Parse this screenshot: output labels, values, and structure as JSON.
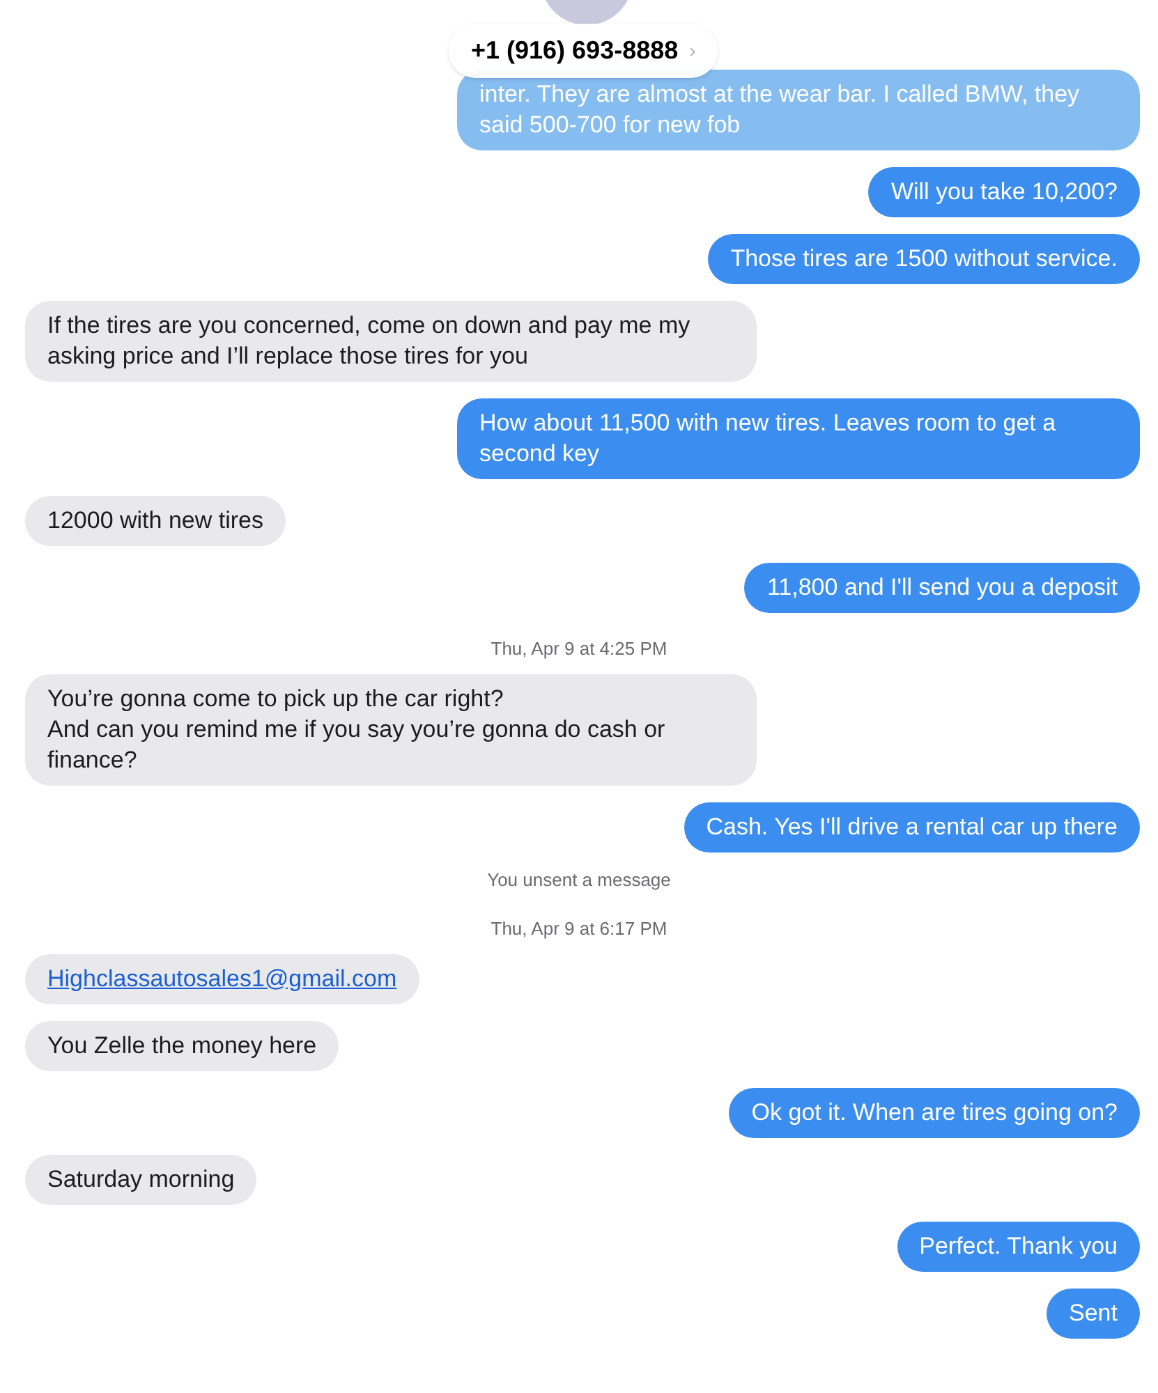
{
  "header": {
    "contact": "+1 (916) 693-8888",
    "chevron": "›"
  },
  "messages": [
    {
      "kind": "sent",
      "text": "inter. They are almost at the wear bar. I called BMW, they said 500-700 for new fob",
      "faded": true
    },
    {
      "kind": "sent",
      "text": "Will you take 10,200?"
    },
    {
      "kind": "sent",
      "text": "Those tires are 1500 without service."
    },
    {
      "kind": "received",
      "text": "If the tires are you concerned, come on down and pay me my asking price and I’ll replace those tires for you"
    },
    {
      "kind": "sent",
      "text": "How about 11,500 with new tires. Leaves room to get a second key"
    },
    {
      "kind": "received",
      "text": "12000 with new tires"
    },
    {
      "kind": "sent",
      "text": "11,800 and I'll send you a deposit"
    },
    {
      "kind": "timestamp",
      "text": "Thu, Apr 9 at 4:25 PM"
    },
    {
      "kind": "received",
      "text": "You’re gonna come to pick up the car right?\nAnd can you remind me if you say you’re gonna do cash or finance?"
    },
    {
      "kind": "sent",
      "text": "Cash. Yes I'll drive a rental car up there"
    },
    {
      "kind": "notice",
      "text": "You unsent a message"
    },
    {
      "kind": "timestamp",
      "text": "Thu, Apr 9 at 6:17 PM"
    },
    {
      "kind": "link",
      "text": "Highclassautosales1@gmail.com"
    },
    {
      "kind": "received",
      "text": "You Zelle the money here"
    },
    {
      "kind": "sent",
      "text": "Ok got it. When are tires going on?"
    },
    {
      "kind": "received",
      "text": "Saturday morning"
    },
    {
      "kind": "sent",
      "text": "Perfect. Thank you"
    },
    {
      "kind": "sent",
      "text": "Sent"
    }
  ]
}
